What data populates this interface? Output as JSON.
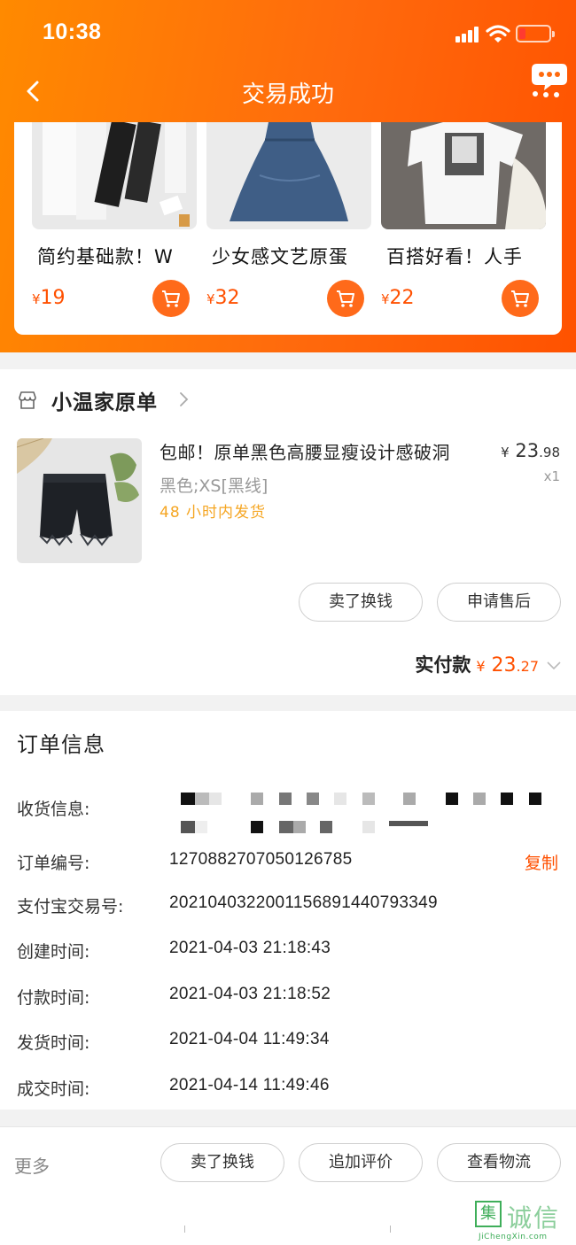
{
  "status_bar": {
    "time": "10:38"
  },
  "nav": {
    "title": "交易成功"
  },
  "recommendations": [
    {
      "title": "简约基础款！W",
      "currency": "¥",
      "price": "19"
    },
    {
      "title": "少女感文艺原蛋",
      "currency": "¥",
      "price": "32"
    },
    {
      "title": "百搭好看！人手",
      "currency": "¥",
      "price": "22"
    }
  ],
  "shop": {
    "name": "小温家原单",
    "product": {
      "title": "包邮！原单黑色高腰显瘦设计感破洞",
      "sku": "黑色;XS[黑线]",
      "shipping": "48 小时内发货",
      "price_currency": "¥",
      "price_int": "23",
      "price_dec": ".98",
      "qty": "x1"
    },
    "buttons": {
      "sell": "卖了换钱",
      "after_sale": "申请售后"
    },
    "paid_label": "实付款",
    "paid_currency": "¥",
    "paid_int": "23",
    "paid_dec": ".27"
  },
  "order_info": {
    "title": "订单信息",
    "shipping_label": "收货信息:",
    "order_no_label": "订单编号:",
    "order_no": "1270882707050126785",
    "copy": "复制",
    "alipay_label": "支付宝交易号:",
    "alipay_no": "2021040322001156891440793349",
    "created_label": "创建时间:",
    "created": "2021-04-03 21:18:43",
    "paid_label": "付款时间:",
    "paid": "2021-04-03 21:18:52",
    "shipped_label": "发货时间:",
    "shipped": "2021-04-04 11:49:34",
    "closed_label": "成交时间:",
    "closed": "2021-04-14 11:49:46"
  },
  "bottom": {
    "more": "更多",
    "sell": "卖了换钱",
    "review": "追加评价",
    "logistics": "查看物流"
  },
  "watermark": {
    "box": "集",
    "chars": "诚信",
    "sub": "JiChengXin.com"
  },
  "colors": {
    "accent": "#ff5000",
    "header_start": "#ff8a00",
    "header_end": "#ff5200",
    "ship": "#f5a623"
  }
}
